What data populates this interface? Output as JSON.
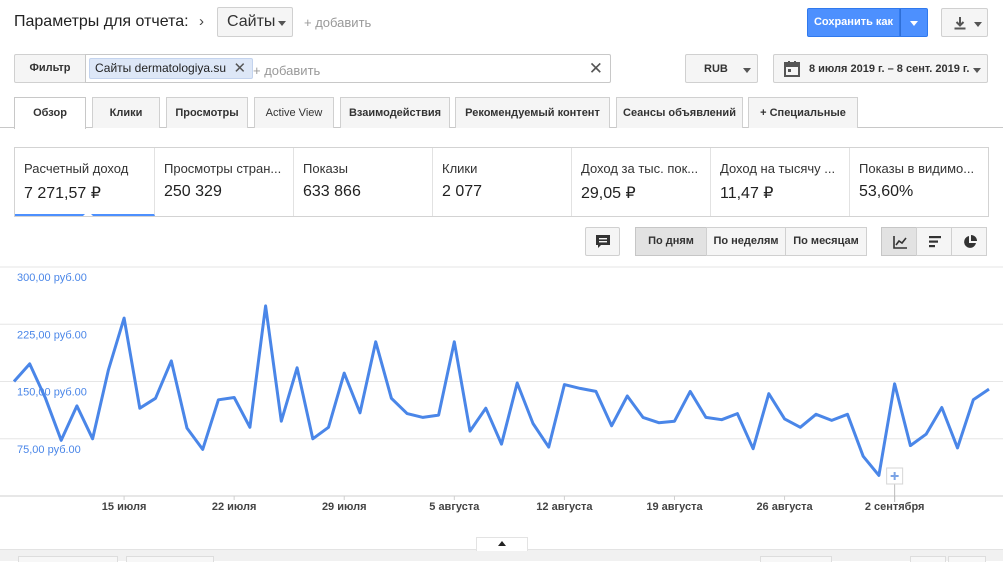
{
  "header": {
    "params_label": "Параметры для отчета:",
    "sites_dropdown": "Сайты",
    "add_link": "+ добавить",
    "save_button": "Сохранить как"
  },
  "filter": {
    "filter_button": "Фильтр",
    "chip_prefix": "Сайты",
    "chip_value": "dermatologiya.su",
    "add_placeholder": "+ добавить"
  },
  "currency": "RUB",
  "date_range": "8 июля 2019 г. – 8 сент. 2019 г.",
  "tabs": [
    {
      "label": "Обзор",
      "active": true
    },
    {
      "label": "Клики"
    },
    {
      "label": "Просмотры"
    },
    {
      "label": "Active View"
    },
    {
      "label": "Взаимодействия"
    },
    {
      "label": "Рекомендуемый контент"
    },
    {
      "label": "Сеансы объявлений"
    },
    {
      "label": "+ Специальные"
    }
  ],
  "metrics": [
    {
      "label": "Расчетный доход",
      "value": "7 271,57 ₽",
      "selected": true
    },
    {
      "label": "Просмотры стран...",
      "value": "250 329"
    },
    {
      "label": "Показы",
      "value": "633 866"
    },
    {
      "label": "Клики",
      "value": "2 077"
    },
    {
      "label": "Доход за тыс. пок...",
      "value": "29,05 ₽"
    },
    {
      "label": "Доход на тысячу ...",
      "value": "11,47 ₽"
    },
    {
      "label": "Показы в видимо...",
      "value": "53,60%"
    }
  ],
  "period_buttons": [
    {
      "label": "По дням",
      "active": true
    },
    {
      "label": "По неделям"
    },
    {
      "label": "По месяцам"
    }
  ],
  "chart_type_icons": [
    "line-chart-icon",
    "bar-chart-icon",
    "pie-chart-icon"
  ],
  "chart_data": {
    "type": "line",
    "ytick_labels": [
      "75,00 руб.00",
      "150,00 руб.00",
      "225,00 руб.00",
      "300,00 руб.00"
    ],
    "yticks": [
      75,
      150,
      225,
      300
    ],
    "ylim": [
      0,
      300
    ],
    "xtick_labels": [
      "15 июля",
      "22 июля",
      "29 июля",
      "5 августа",
      "12 августа",
      "19 августа",
      "26 августа",
      "2 сентября"
    ],
    "xtick_day_index": [
      7,
      14,
      21,
      28,
      35,
      42,
      49,
      56
    ],
    "x_first_day": "8 июля 2019",
    "series": [
      {
        "color": "#4a86e8",
        "values": [
          150,
          173,
          128,
          73,
          118,
          75,
          165,
          233,
          115,
          128,
          177,
          89,
          61,
          126,
          129,
          90,
          249,
          98,
          168,
          75,
          90,
          161,
          109,
          202,
          128,
          108,
          103,
          106,
          202,
          85,
          115,
          68,
          148,
          95,
          64,
          146,
          141,
          137,
          92,
          131,
          103,
          96,
          98,
          137,
          103,
          100,
          108,
          62,
          134,
          101,
          90,
          107,
          99,
          107,
          52,
          27,
          147,
          66,
          81,
          116,
          63,
          126,
          140
        ]
      }
    ],
    "annotation_marker_day": 56,
    "grid": true,
    "legend": "none"
  }
}
